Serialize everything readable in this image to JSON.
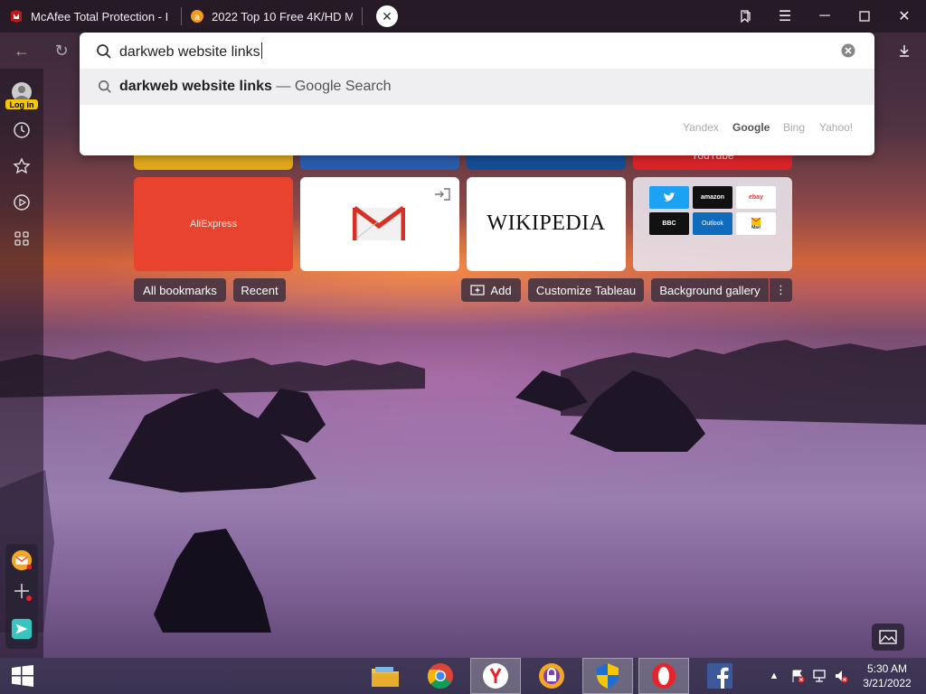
{
  "tabs": [
    {
      "title": "McAfee Total Protection - I",
      "icon": "mcafee-icon"
    },
    {
      "title": "2022 Top 10 Free 4K/HD M",
      "icon": "bitty-icon"
    }
  ],
  "sidebar": {
    "login_label": "Log in",
    "items": [
      "history-icon",
      "bookmarks-star-icon",
      "video-play-icon",
      "apps-grid-icon"
    ]
  },
  "omnibox": {
    "query": "darkweb website links",
    "suggestion_bold": "darkweb website links",
    "suggestion_rest": " — Google Search",
    "engines": [
      "Yandex",
      "Google",
      "Bing",
      "Yahoo!"
    ],
    "active_engine": "Google"
  },
  "tiles": {
    "youtube_partial": "YouTube",
    "aliexpress": "AliExpress",
    "wikipedia": "WIKIPEDIA",
    "mini_sites": [
      "twitter",
      "amazon",
      "ebay",
      "BBC",
      "Outlook",
      "Mail"
    ]
  },
  "chips": {
    "all_bookmarks": "All bookmarks",
    "recent": "Recent",
    "add": "Add",
    "customize": "Customize Tableau",
    "background_gallery": "Background gallery"
  },
  "taskbar": {
    "time": "5:30 AM",
    "date": "3/21/2022"
  },
  "colors": {
    "aliexpress": "#e8432e",
    "youtube": "#d9232a",
    "login_badge": "#f6c700",
    "twitter": "#1da1f2",
    "outlook": "#0f6cbd"
  }
}
